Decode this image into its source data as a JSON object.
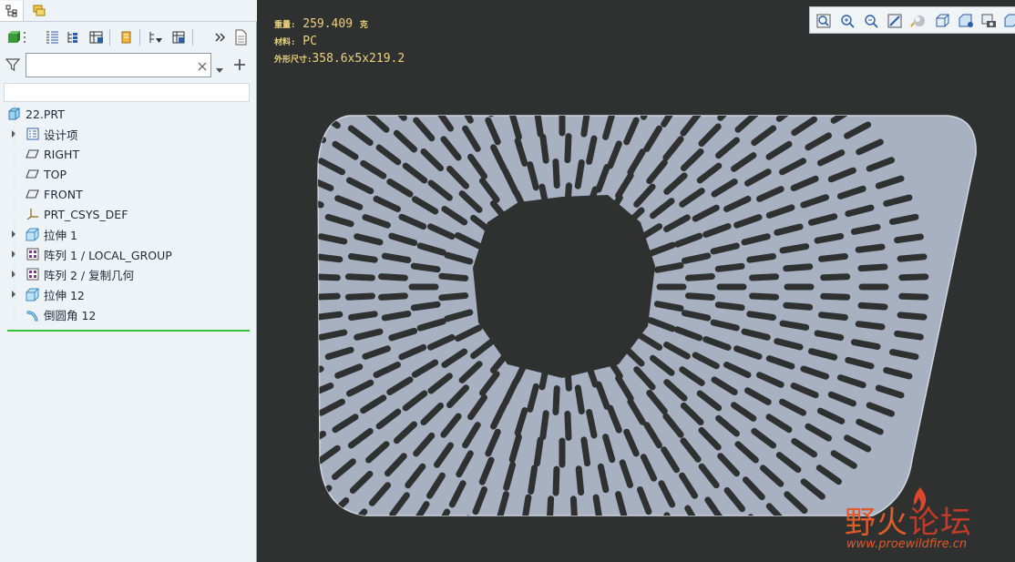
{
  "model_tree": {
    "filter": {
      "value": "",
      "placeholder": ""
    },
    "items": [
      {
        "label": "22.PRT",
        "icon": "part-icon"
      },
      {
        "label": "设计项",
        "icon": "design-items-icon"
      },
      {
        "label": "RIGHT",
        "icon": "datum-plane-icon"
      },
      {
        "label": "TOP",
        "icon": "datum-plane-icon"
      },
      {
        "label": "FRONT",
        "icon": "datum-plane-icon"
      },
      {
        "label": "PRT_CSYS_DEF",
        "icon": "csys-icon"
      },
      {
        "label": "拉伸 1",
        "icon": "extrude-icon"
      },
      {
        "label": "阵列 1 / LOCAL_GROUP",
        "icon": "pattern-icon"
      },
      {
        "label": "阵列 2 / 复制几何",
        "icon": "pattern-icon"
      },
      {
        "label": "拉伸 12",
        "icon": "extrude-icon"
      },
      {
        "label": "倒圆角 12",
        "icon": "round-icon"
      }
    ]
  },
  "model_info": {
    "mass_label": "重量:",
    "mass_value": "259.409",
    "mass_unit": "克",
    "material_label": "材料:",
    "material_value": "PC",
    "size_label": "外形尺寸:",
    "size_value": "358.6x5x219.2"
  },
  "watermark": {
    "title_a": "野火",
    "title_b": "论坛",
    "url": "www.proewildfire.cn"
  },
  "colors": {
    "graphics_bg": "#2f3131",
    "part_fill": "#a7b1c2",
    "info_text": "#ecd27a",
    "insert_line": "#36c436"
  }
}
